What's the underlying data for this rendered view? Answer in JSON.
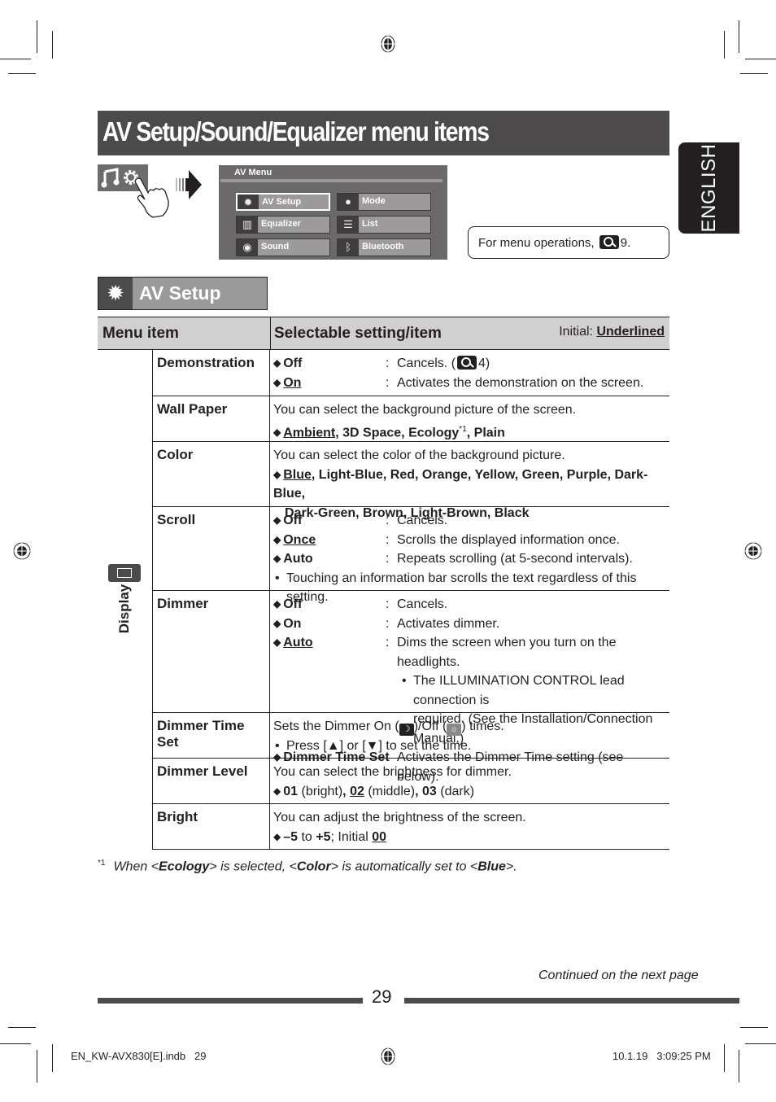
{
  "page": {
    "title": "AV Setup/Sound/Equalizer menu items",
    "language_tab": "ENGLISH",
    "page_number": "29",
    "continued": "Continued on the next page",
    "slug_file": "EN_KW-AVX830[E].indb   29",
    "slug_timestamp": "10.1.19   3:09:25 PM"
  },
  "av_menu": {
    "title": "AV Menu",
    "buttons": [
      {
        "label": "AV Setup",
        "icon": "gear-icon",
        "selected": true
      },
      {
        "label": "Mode",
        "icon": "mode-icon",
        "selected": false
      },
      {
        "label": "Equalizer",
        "icon": "equalizer-icon",
        "selected": false
      },
      {
        "label": "List",
        "icon": "list-icon",
        "selected": false
      },
      {
        "label": "Sound",
        "icon": "sound-icon",
        "selected": false
      },
      {
        "label": "Bluetooth",
        "icon": "bluetooth-icon",
        "selected": false
      }
    ]
  },
  "operations_note": {
    "text": "For menu operations,",
    "page_ref": "9."
  },
  "section": {
    "title": "AV Setup",
    "icon": "gear-icon"
  },
  "table": {
    "header": {
      "col1": "Menu item",
      "col2": "Selectable setting/item",
      "initial_label": "Initial:",
      "initial_value": "Underlined"
    },
    "group_label": "Display",
    "rows": {
      "demonstration": {
        "name": "Demonstration",
        "options": [
          {
            "key": "Off",
            "desc": "Cancels. (",
            "ref": "4)"
          },
          {
            "key": "On",
            "desc": "Activates the demonstration on the screen.",
            "initial": true
          }
        ]
      },
      "wall_paper": {
        "name": "Wall Paper",
        "intro": "You can select the background picture of the screen.",
        "values": [
          "Ambient",
          "3D Space",
          "Ecology",
          "Plain"
        ],
        "initial": "Ambient",
        "footnote_mark": "*1"
      },
      "color": {
        "name": "Color",
        "intro": "You can select the color of the background picture.",
        "values_line1": [
          "Blue",
          "Light-Blue",
          "Red",
          "Orange",
          "Yellow",
          "Green",
          "Purple",
          "Dark-Blue"
        ],
        "values_line2": "Dark-Green, Brown, Light-Brown, Black",
        "initial": "Blue"
      },
      "scroll": {
        "name": "Scroll",
        "options": [
          {
            "key": "Off",
            "desc": "Cancels."
          },
          {
            "key": "Once",
            "desc": "Scrolls the displayed information once.",
            "initial": true
          },
          {
            "key": "Auto",
            "desc": "Repeats scrolling (at 5-second intervals)."
          }
        ],
        "note": "Touching an information bar scrolls the text regardless of this setting."
      },
      "dimmer": {
        "name": "Dimmer",
        "options": [
          {
            "key": "Off",
            "desc": "Cancels."
          },
          {
            "key": "On",
            "desc": "Activates dimmer."
          },
          {
            "key": "Auto",
            "desc": "Dims the screen when you turn on the headlights.",
            "initial": true
          },
          {
            "key": "Dimmer Time Set",
            "desc": "Activates the Dimmer Time setting (see below)."
          }
        ],
        "auto_note_1": "The ILLUMINATION CONTROL lead connection is",
        "auto_note_2": "required. (See the Installation/Connection Manual.)"
      },
      "dimmer_time_set": {
        "name": "Dimmer Time Set",
        "text_a": "Sets the Dimmer On (",
        "text_b": ")/Off (",
        "text_c": ") times.",
        "note_a": "Press [",
        "note_b": "] or [",
        "note_c": "] to set the time.",
        "up_symbol": "▲",
        "down_symbol": "▼"
      },
      "dimmer_level": {
        "name": "Dimmer Level",
        "intro": "You can select the brightness for dimmer.",
        "levels": [
          {
            "value": "01",
            "label": "(bright)"
          },
          {
            "value": "02",
            "label": "(middle)",
            "initial": true
          },
          {
            "value": "03",
            "label": "(dark)"
          }
        ]
      },
      "bright": {
        "name": "Bright",
        "intro": "You can adjust the brightness of the screen.",
        "min": "–5",
        "to": "to",
        "max": "+5",
        "initial_label": "; Initial",
        "initial_value": "00"
      }
    }
  },
  "footnote": {
    "mark": "*1",
    "t1": "When <",
    "b1": "Ecology",
    "t2": "> is selected, <",
    "b2": "Color",
    "t3": "> is automatically set to <",
    "b3": "Blue",
    "t4": ">."
  }
}
